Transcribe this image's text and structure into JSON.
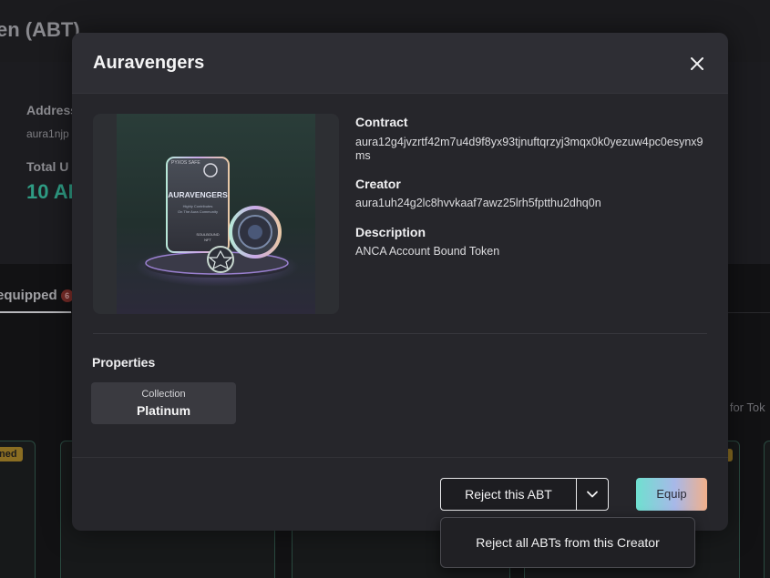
{
  "background": {
    "page_title": "en (ABT)",
    "address_label": "Address",
    "address_value": "aura1njp",
    "total_label": "Total U",
    "total_value": "10 AB",
    "tab_label": "equipped",
    "tab_badge": "6",
    "search_placeholder": "h for Tok",
    "card_badge": "ned"
  },
  "modal": {
    "title": "Auravengers",
    "contract_label": "Contract",
    "contract_value": "aura12g4jvzrtf42m7u4d9f8yx93tjnuftqrzyj3mqx0k0yezuw4pc0esynx9ms",
    "creator_label": "Creator",
    "creator_value": "aura1uh24g2lc8hvvkaaf7awz25lrh5fptthu2dhq0n",
    "description_label": "Description",
    "description_value": "ANCA Account Bound Token",
    "properties_title": "Properties",
    "properties": [
      {
        "type": "Collection",
        "value": "Platinum"
      }
    ],
    "reject_label": "Reject this ABT",
    "equip_label": "Equip",
    "dropdown_item": "Reject all ABTs from this Creator"
  },
  "nft_art": {
    "card_top_text": "PYXOS SAFE",
    "card_name": "AURAVENGERS",
    "card_sub1": "Highly Contributes",
    "card_sub2": "On The Aura Community",
    "card_bottom1": "SOULBOUND",
    "card_bottom2": "NFT"
  },
  "colors": {
    "accent_green": "#2f9c84",
    "equip_gradient_start": "#6fe0d0",
    "equip_gradient_end": "#f2b08a"
  }
}
